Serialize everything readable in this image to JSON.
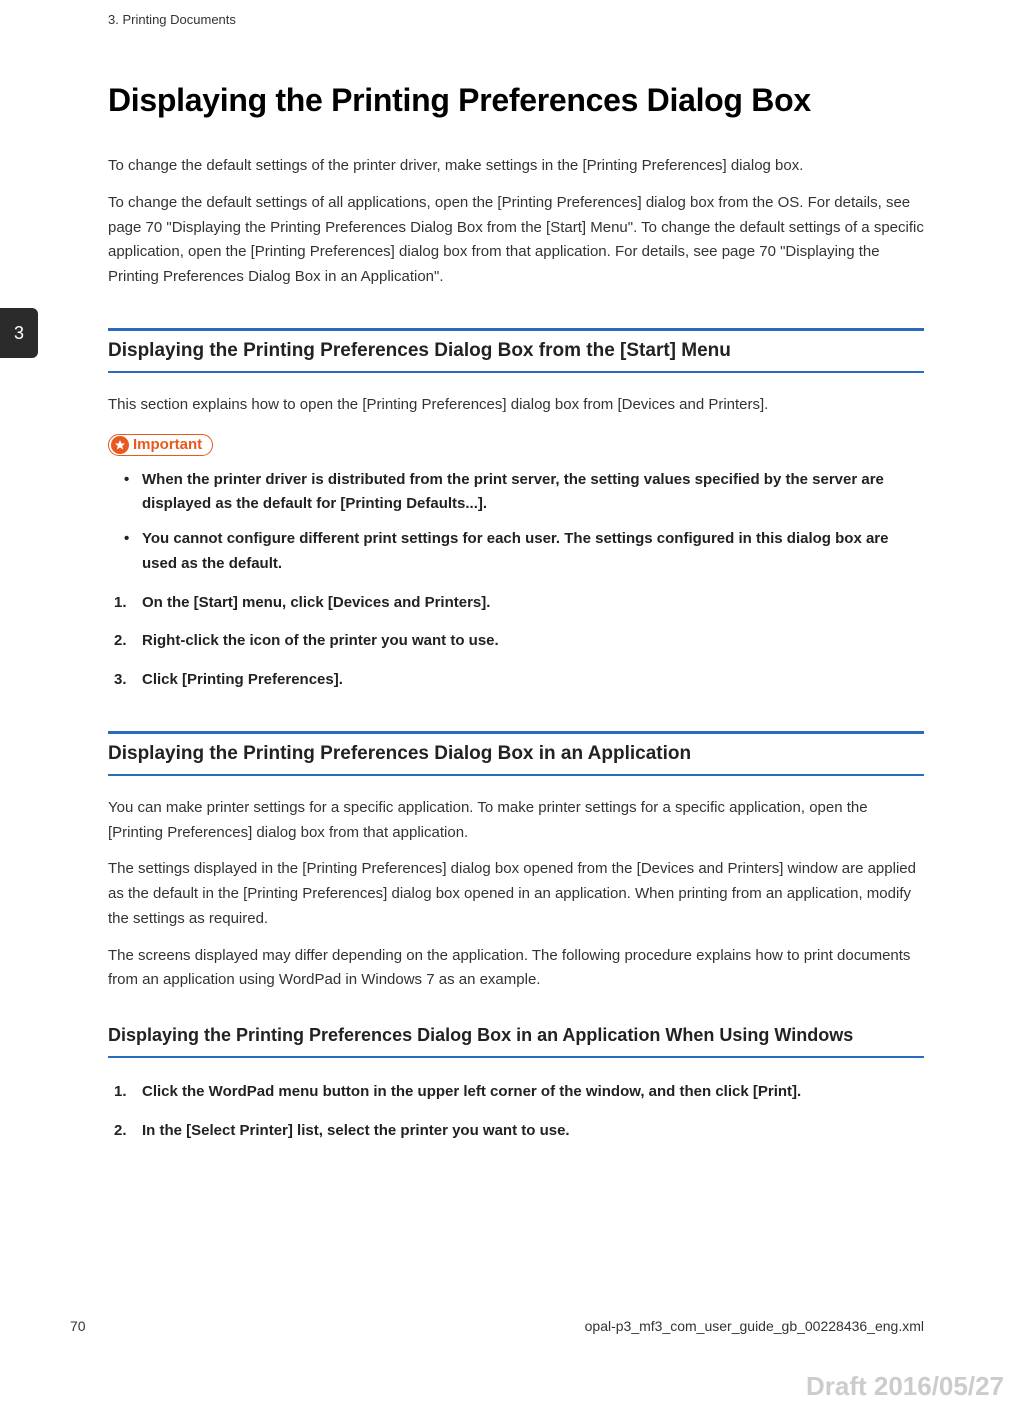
{
  "header": {
    "breadcrumb": "3. Printing Documents"
  },
  "tab": {
    "number": "3"
  },
  "title": "Displaying the Printing Preferences Dialog Box",
  "intro": {
    "p1": "To change the default settings of the printer driver, make settings in the [Printing Preferences] dialog box.",
    "p2": "To change the default settings of all applications, open the [Printing Preferences] dialog box from the OS. For details, see page 70 \"Displaying the Printing Preferences Dialog Box from the [Start] Menu\". To change the default settings of a specific application, open the [Printing Preferences] dialog box from that application. For details, see page 70 \"Displaying the Printing Preferences Dialog Box in an Application\"."
  },
  "section1": {
    "heading": "Displaying the Printing Preferences Dialog Box from the [Start] Menu",
    "intro": "This section explains how to open the [Printing Preferences] dialog box from [Devices and Printers].",
    "important_label": "Important",
    "important_items": [
      "When the printer driver is distributed from the print server, the setting values specified by the server are displayed as the default for [Printing Defaults...].",
      "You cannot configure different print settings for each user. The settings configured in this dialog box are used as the default."
    ],
    "steps": [
      "On the [Start] menu, click [Devices and Printers].",
      "Right-click the icon of the printer you want to use.",
      "Click [Printing Preferences]."
    ]
  },
  "section2": {
    "heading": "Displaying the Printing Preferences Dialog Box in an Application",
    "p1": "You can make printer settings for a specific application. To make printer settings for a specific application, open the [Printing Preferences] dialog box from that application.",
    "p2": "The settings displayed in the [Printing Preferences] dialog box opened from the [Devices and Printers] window are applied as the default in the [Printing Preferences] dialog box opened in an application. When printing from an application, modify the settings as required.",
    "p3": "The screens displayed may differ depending on the application. The following procedure explains how to print documents from an application using WordPad in Windows 7 as an example.",
    "subheading": "Displaying the Printing Preferences Dialog Box in an Application When Using Windows",
    "steps": [
      "Click the WordPad menu button in the upper left corner of the window, and then click [Print].",
      "In the [Select Printer] list, select the printer you want to use."
    ]
  },
  "footer": {
    "page_number": "70",
    "filename": "opal-p3_mf3_com_user_guide_gb_00228436_eng.xml",
    "draft": "Draft 2016/05/27"
  }
}
